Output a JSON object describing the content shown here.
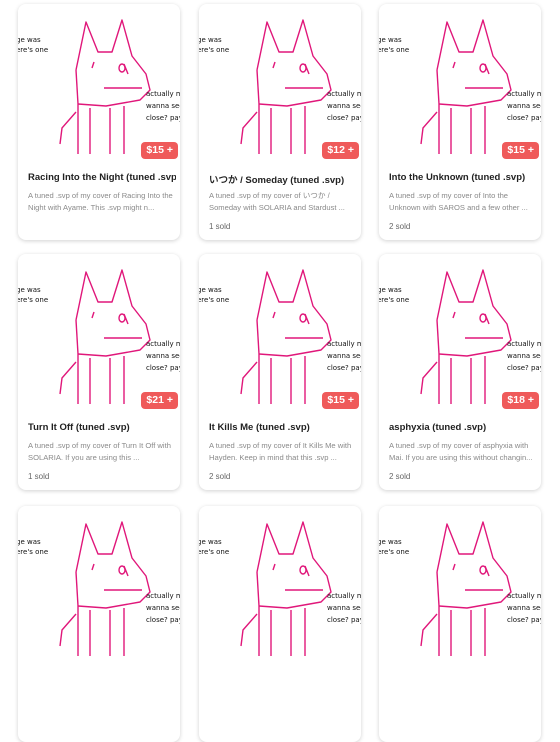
{
  "cover_art": {
    "top_text": [
      "ge was",
      "ere's one"
    ],
    "side_text": [
      "actually m",
      "wanna see n",
      "close? pay r"
    ]
  },
  "products": [
    {
      "title": "Racing Into the Night (tuned .svp)",
      "price": "$15 +",
      "description": "A tuned .svp of my cover of Racing Into the Night with Ayame. This .svp might n...",
      "sold": ""
    },
    {
      "title": "いつか / Someday (tuned .svp)",
      "price": "$12 +",
      "description": "A tuned .svp of my cover of いつか / Someday with SOLARIA and Stardust ...",
      "sold": "1 sold"
    },
    {
      "title": "Into the Unknown (tuned .svp)",
      "price": "$15 +",
      "description": "A tuned .svp of my cover of Into the Unknown with SAROS and a few other ...",
      "sold": "2 sold"
    },
    {
      "title": "Turn It Off (tuned .svp)",
      "price": "$21 +",
      "description": "A tuned .svp of my cover of Turn It Off with SOLARIA. If you are using this ...",
      "sold": "1 sold"
    },
    {
      "title": "It Kills Me (tuned .svp)",
      "price": "$15 +",
      "description": "A tuned .svp of my cover of It Kills Me with Hayden. Keep in mind that this .svp ...",
      "sold": "2 sold"
    },
    {
      "title": "asphyxia (tuned .svp)",
      "price": "$18 +",
      "description": "A tuned .svp of my cover of asphyxia with Mai. If you are using this without changin...",
      "sold": "2 sold"
    },
    {
      "title": "",
      "price": "",
      "description": "",
      "sold": ""
    },
    {
      "title": "",
      "price": "",
      "description": "",
      "sold": ""
    },
    {
      "title": "",
      "price": "",
      "description": "",
      "sold": ""
    }
  ],
  "colors": {
    "accent": "#ef5a5a",
    "sketch": "#e0177a"
  }
}
